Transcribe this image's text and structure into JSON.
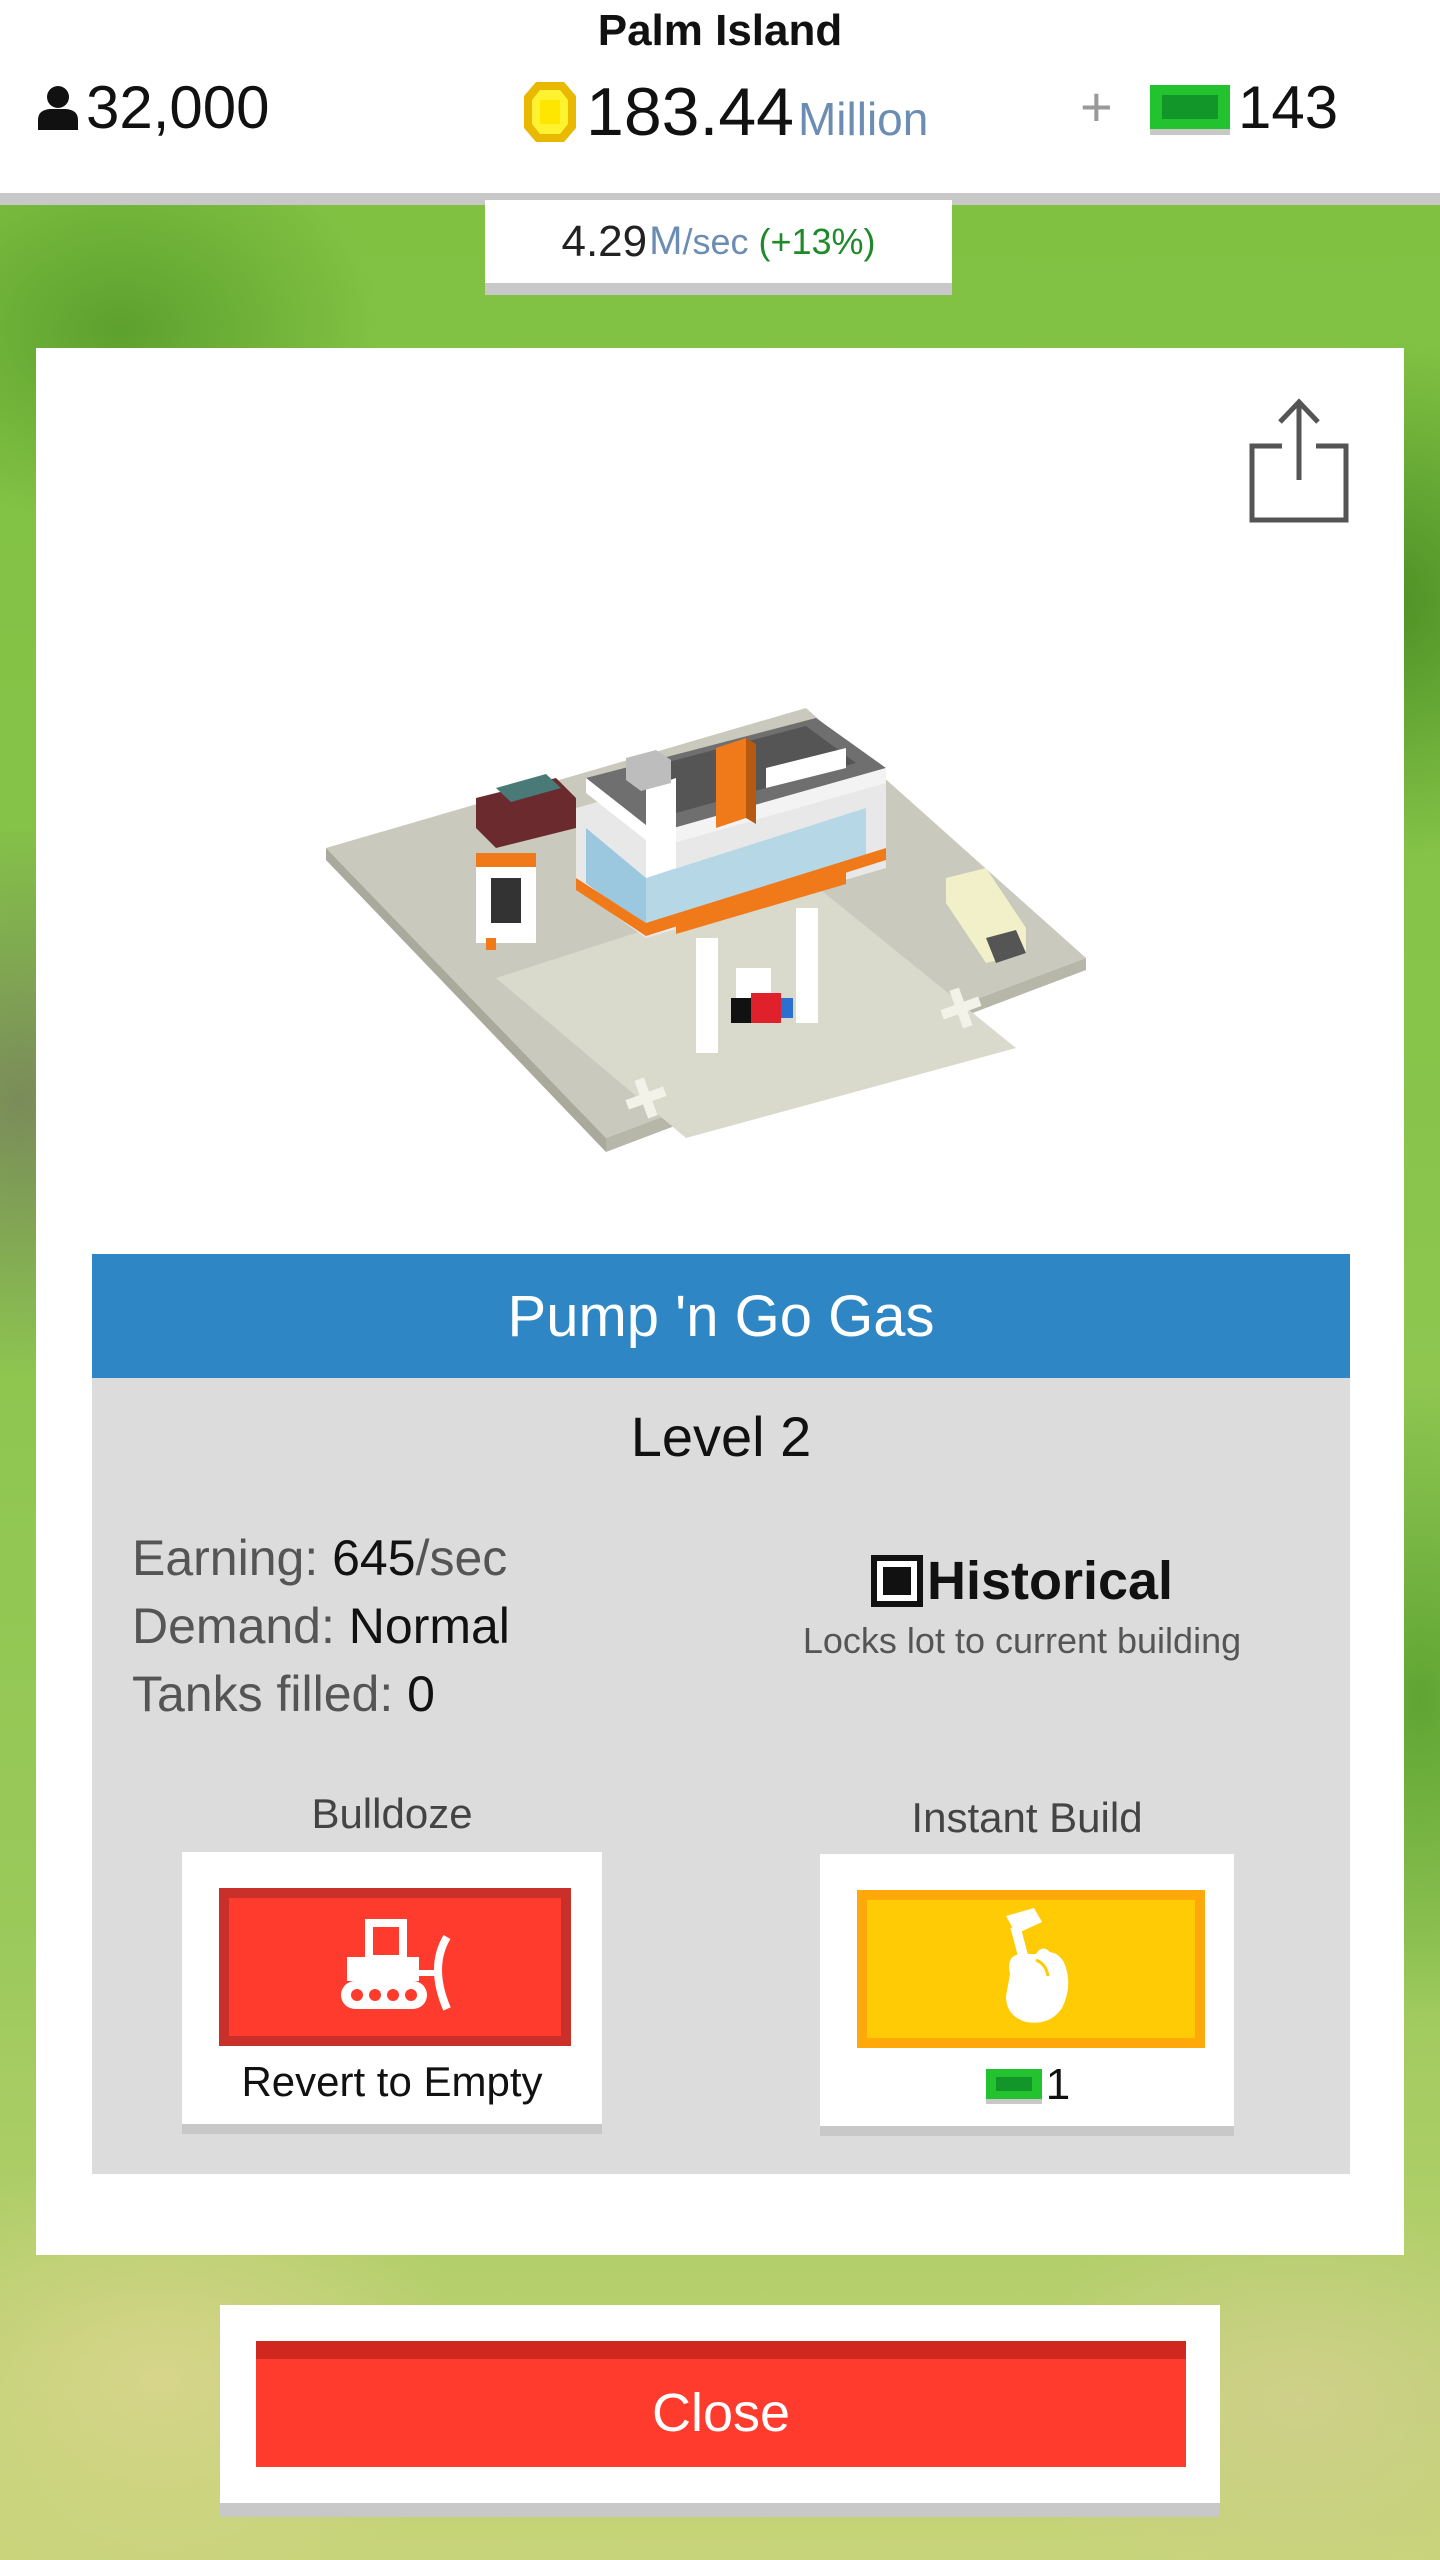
{
  "header": {
    "island_name": "Palm Island",
    "population": "32,000",
    "coins_value": "183.44",
    "coins_unit": "Million",
    "plus": "+",
    "cash": "143",
    "income_rate": "4.29",
    "income_rate_unit": "M",
    "income_rate_suffix": "/sec",
    "income_bonus": "(+13%)"
  },
  "building": {
    "name": "Pump 'n Go Gas",
    "level": "Level 2",
    "earning_label": "Earning: ",
    "earning_value": "645",
    "earning_unit": "/sec",
    "demand_label": "Demand: ",
    "demand_value": "Normal",
    "tanks_label": "Tanks filled: ",
    "tanks_value": "0",
    "historical_label": "Historical",
    "historical_checked": true,
    "historical_desc": "Locks lot to current building"
  },
  "actions": {
    "bulldoze_label": "Bulldoze",
    "bulldoze_caption": "Revert to Empty",
    "instant_label": "Instant Build",
    "instant_cost": "1"
  },
  "footer": {
    "close_label": "Close"
  },
  "icons": {
    "population": "person-icon",
    "coins": "coin-icon",
    "cash": "green-cash-icon",
    "share": "share-icon",
    "bulldoze": "bulldozer-icon",
    "instant": "hammer-hand-icon"
  },
  "colors": {
    "title_bar": "#2e86c4",
    "bulldoze": "#ff3b2e",
    "instant": "#ffcb05",
    "close": "#ff3b2e",
    "cash": "#22c32e",
    "bonus_text": "#1e8a2a"
  }
}
